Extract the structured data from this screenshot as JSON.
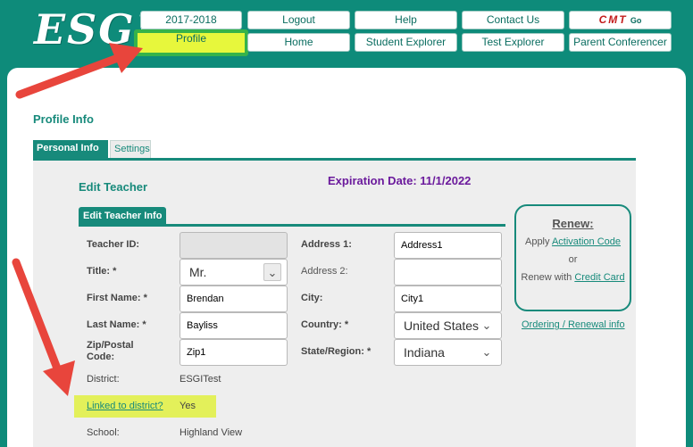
{
  "header": {
    "logo": "ESGI",
    "nav_top": [
      "2017-2018",
      "Logout",
      "Help",
      "Contact Us"
    ],
    "cmt": {
      "label": "CMT",
      "go": "Go"
    },
    "nav_bottom": [
      "Profile",
      "Home",
      "Student Explorer",
      "Test Explorer",
      "Parent Conferencer"
    ]
  },
  "page": {
    "title": "Profile Info",
    "tabs": [
      "Personal Info",
      "Settings"
    ]
  },
  "edit": {
    "title": "Edit Teacher",
    "expiration": "Expiration Date: 11/1/2022",
    "subtab": "Edit Teacher Info"
  },
  "form": {
    "teacher_id_label": "Teacher ID:",
    "teacher_id_value": "",
    "title_label": "Title: *",
    "title_value": "Mr.",
    "first_name_label": "First Name: *",
    "first_name_value": "Brendan",
    "last_name_label": "Last Name: *",
    "last_name_value": "Bayliss",
    "zip_label_1": "Zip/Postal",
    "zip_label_2": "Code:",
    "zip_value": "Zip1",
    "district_label": "District:",
    "district_value": "ESGITest",
    "linked_label": "Linked to district?",
    "linked_value": "Yes",
    "school_label": "School:",
    "school_value": "Highland View",
    "address1_label": "Address 1:",
    "address1_value": "Address1",
    "address2_label": "Address 2:",
    "address2_value": "",
    "city_label": "City:",
    "city_value": "City1",
    "country_label": "Country: *",
    "country_value": "United States",
    "state_label": "State/Region: *",
    "state_value": "Indiana"
  },
  "renew": {
    "title": "Renew:",
    "apply": "Apply",
    "activation_link": "Activation Code",
    "or": "or",
    "renew_with": "Renew with",
    "credit_card_link": "Credit Card",
    "ordering_link": "Ordering / Renewal info"
  },
  "colors": {
    "teal": "#0e8b7a",
    "highlight": "#e7f73c",
    "arrow": "#e8453c",
    "purple": "#6b1a9c"
  }
}
